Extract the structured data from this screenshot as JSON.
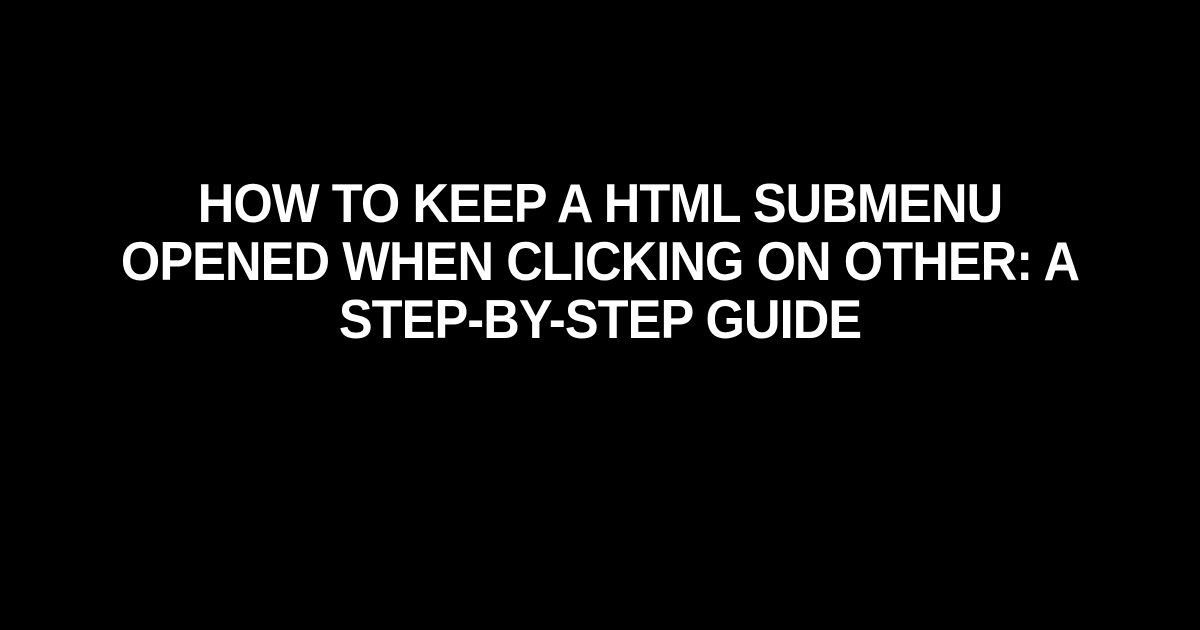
{
  "title": "How to Keep a HTML Submenu Opened When Clicking on Other: A Step-by-Step Guide"
}
